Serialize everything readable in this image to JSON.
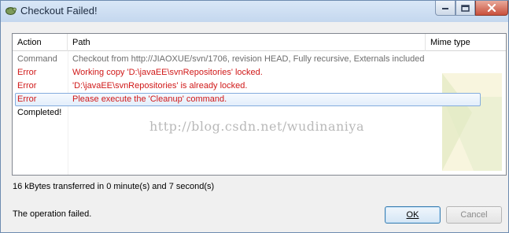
{
  "window": {
    "title": "Checkout Failed!",
    "accent_title_gradient": [
      "#d9e7f7",
      "#c4d7ee"
    ]
  },
  "columns": {
    "action": "Action",
    "path": "Path",
    "mime": "Mime type"
  },
  "rows": [
    {
      "kind": "command",
      "action": "Command",
      "path": "Checkout from http://JIAOXUE/svn/1706, revision HEAD, Fully recursive, Externals included"
    },
    {
      "kind": "error",
      "action": "Error",
      "path": "Working copy 'D:\\javaEE\\svnRepositories' locked."
    },
    {
      "kind": "error",
      "action": "Error",
      "path": "'D:\\javaEE\\svnRepositories' is already locked."
    },
    {
      "kind": "error",
      "action": "Error",
      "path": "Please execute the 'Cleanup' command.",
      "selected": true
    },
    {
      "kind": "done",
      "action": "Completed!",
      "path": ""
    }
  ],
  "watermark": {
    "url": "http://blog.csdn.net/wudinaniya"
  },
  "transfer_text": "16 kBytes transferred in 0 minute(s) and 7 second(s)",
  "status_text": "The operation failed.",
  "buttons": {
    "ok": "OK",
    "cancel": "Cancel"
  },
  "colors": {
    "error": "#d01818",
    "command": "#6d6d6d",
    "selection_border": "#84acdd"
  }
}
